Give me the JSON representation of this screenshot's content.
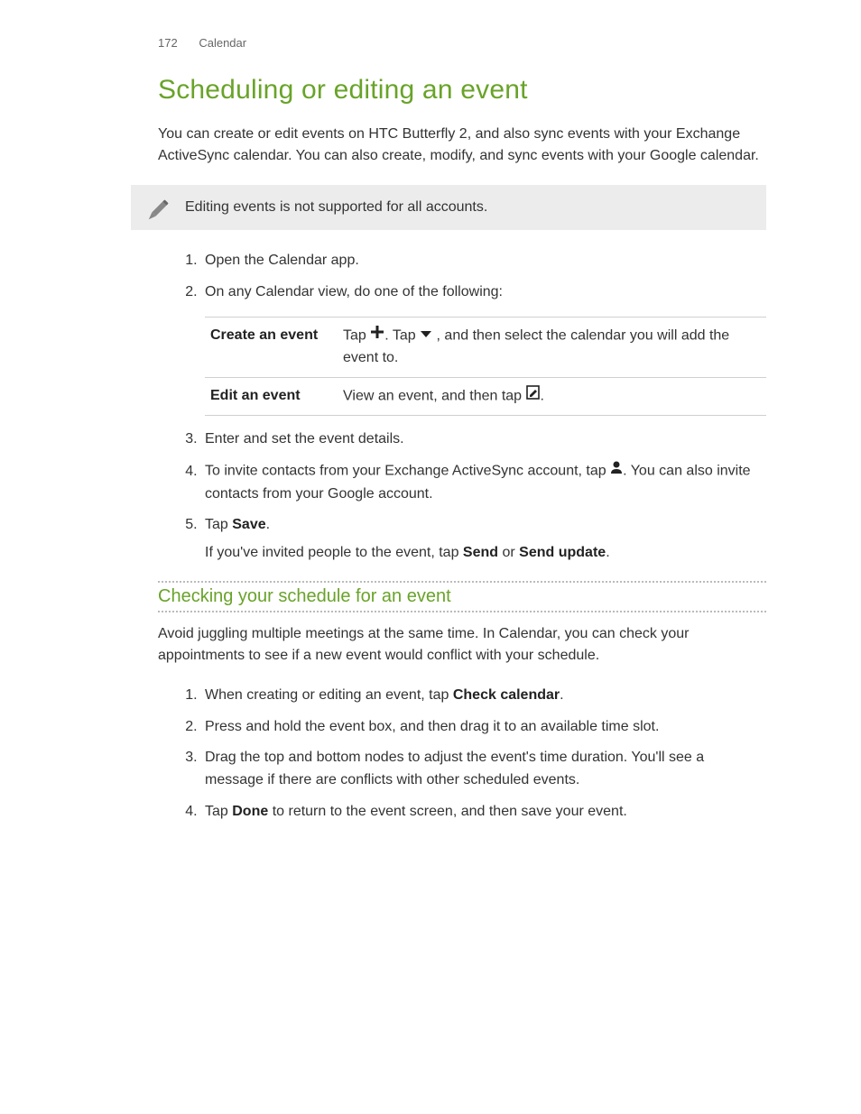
{
  "header": {
    "page_number": "172",
    "section": "Calendar"
  },
  "title": "Scheduling or editing an event",
  "intro": "You can create or edit events on HTC Butterfly 2, and also sync events with your Exchange ActiveSync calendar. You can also create, modify, and sync events with your Google calendar.",
  "note": "Editing events is not supported for all accounts.",
  "steps": {
    "s1": "Open the Calendar app.",
    "s2": "On any Calendar view, do one of the following:",
    "table": {
      "row1_label": "Create an event",
      "row1_a": "Tap ",
      "row1_b": ". Tap ",
      "row1_c": " , and then select the calendar you will add the event to.",
      "row2_label": "Edit an event",
      "row2_a": "View an event, and then tap ",
      "row2_b": "."
    },
    "s3": "Enter and set the event details.",
    "s4_a": "To invite contacts from your Exchange ActiveSync account, tap ",
    "s4_b": ". You can also invite contacts from your Google account.",
    "s5_a": "Tap ",
    "s5_b": "Save",
    "s5_c": ".",
    "s5_note_a": "If you've invited people to the event, tap ",
    "s5_note_b": "Send",
    "s5_note_c": " or ",
    "s5_note_d": "Send update",
    "s5_note_e": "."
  },
  "subheading": "Checking your schedule for an event",
  "sub_intro": "Avoid juggling multiple meetings at the same time. In Calendar, you can check your appointments to see if a new event would conflict with your schedule.",
  "substeps": {
    "s1_a": "When creating or editing an event, tap ",
    "s1_b": "Check calendar",
    "s1_c": ".",
    "s2": "Press and hold the event box, and then drag it to an available time slot.",
    "s3": "Drag the top and bottom nodes to adjust the event's time duration. You'll see a message if there are conflicts with other scheduled events.",
    "s4_a": "Tap ",
    "s4_b": "Done",
    "s4_c": " to return to the event screen, and then save your event."
  }
}
